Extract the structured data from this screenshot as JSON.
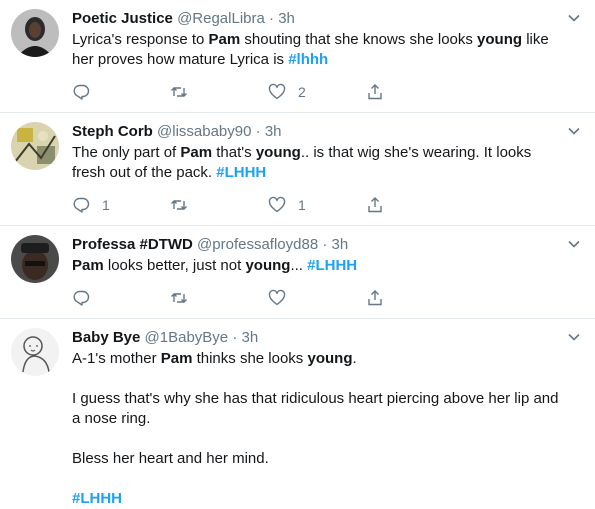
{
  "tweets": [
    {
      "name": "Poetic Justice",
      "handle": "@RegalLibra",
      "separator": "·",
      "time": "3h",
      "avatar": "profile-photo",
      "paragraphs": [
        [
          {
            "t": "Lyrica's response to ",
            "k": "text"
          },
          {
            "t": "Pam",
            "k": "bold"
          },
          {
            "t": " shouting that she knows she looks ",
            "k": "text"
          },
          {
            "t": "young",
            "k": "bold"
          },
          {
            "t": " like her proves how mature Lyrica is ",
            "k": "text"
          },
          {
            "t": "#lhhh",
            "k": "tag"
          }
        ]
      ],
      "replies": "",
      "retweets": "",
      "likes": "2"
    },
    {
      "name": "Steph Corb",
      "handle": "@lissababy90",
      "separator": "·",
      "time": "3h",
      "avatar": "profile-photo",
      "paragraphs": [
        [
          {
            "t": "The only part of ",
            "k": "text"
          },
          {
            "t": "Pam",
            "k": "bold"
          },
          {
            "t": " that's ",
            "k": "text"
          },
          {
            "t": "young",
            "k": "bold"
          },
          {
            "t": ".. is that wig she's wearing. It looks fresh out of the pack. ",
            "k": "text"
          },
          {
            "t": "#LHHH",
            "k": "tag"
          }
        ]
      ],
      "replies": "1",
      "retweets": "",
      "likes": "1"
    },
    {
      "name": "Professa #DTWD",
      "handle": "@professafloyd88",
      "separator": "·",
      "time": "3h",
      "avatar": "profile-photo",
      "paragraphs": [
        [
          {
            "t": "Pam",
            "k": "bold"
          },
          {
            "t": " looks better, just not ",
            "k": "text"
          },
          {
            "t": "young",
            "k": "bold"
          },
          {
            "t": "... ",
            "k": "text"
          },
          {
            "t": "#LHHH",
            "k": "tag"
          }
        ]
      ],
      "replies": "",
      "retweets": "",
      "likes": ""
    },
    {
      "name": "Baby Bye",
      "handle": "@1BabyBye",
      "separator": "·",
      "time": "3h",
      "avatar": "profile-photo",
      "paragraphs": [
        [
          {
            "t": "A-1's mother ",
            "k": "text"
          },
          {
            "t": "Pam",
            "k": "bold"
          },
          {
            "t": " thinks she looks ",
            "k": "text"
          },
          {
            "t": "young",
            "k": "bold"
          },
          {
            "t": ".",
            "k": "text"
          }
        ],
        [
          {
            "t": "I guess that's why she has that ridiculous heart piercing above her lip and a nose ring.",
            "k": "text"
          }
        ],
        [
          {
            "t": "Bless her heart and her mind.",
            "k": "text"
          }
        ],
        [
          {
            "t": "#LHHH",
            "k": "tag"
          }
        ]
      ],
      "replies": "",
      "retweets": "",
      "likes": ""
    }
  ],
  "icons": {
    "reply": "reply-icon",
    "retweet": "retweet-icon",
    "like": "heart-icon",
    "share": "share-icon",
    "menu": "chevron-down-icon"
  },
  "colors": {
    "link": "#1da1f2",
    "muted": "#657786",
    "text": "#14171a",
    "divider": "#e6ecf0"
  }
}
